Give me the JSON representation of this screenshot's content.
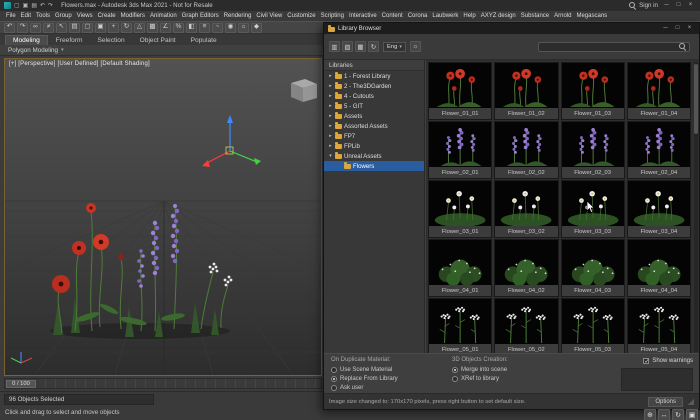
{
  "colors": {
    "selection_blue": "#2a5d9f",
    "folder_yellow": "#d9a63f",
    "poppy_red": "#c23020",
    "lupine_purple": "#9b80d2",
    "viewport_border": "#7a6234"
  },
  "titlebar": {
    "title": "Flowers.max - Autodesk 3ds Max 2021 - Not for Resale",
    "sign_in": "Sign in",
    "quick_access": [
      {
        "name": "new-scene-icon",
        "glyph": "▢"
      },
      {
        "name": "open-file-icon",
        "glyph": "▣"
      },
      {
        "name": "save-file-icon",
        "glyph": "▤"
      },
      {
        "name": "undo-icon",
        "glyph": "↶"
      },
      {
        "name": "redo-icon",
        "glyph": "↷"
      }
    ],
    "window_buttons": [
      {
        "name": "minimize-button",
        "glyph": "─"
      },
      {
        "name": "maximize-button",
        "glyph": "□"
      },
      {
        "name": "close-button",
        "glyph": "×"
      }
    ]
  },
  "menubar": {
    "items": [
      "File",
      "Edit",
      "Tools",
      "Group",
      "Views",
      "Create",
      "Modifiers",
      "Animation",
      "Graph Editors",
      "Rendering",
      "Civil View",
      "Customize",
      "Scripting",
      "Interactive",
      "Content",
      "Corona",
      "Laubwerk",
      "Help",
      "AXYZ design",
      "Substance",
      "Arnold",
      "Megascans"
    ]
  },
  "toolbar": {
    "icons": [
      {
        "name": "undo-icon",
        "glyph": "↶"
      },
      {
        "name": "redo-icon",
        "glyph": "↷"
      },
      {
        "name": "select-and-link-icon",
        "glyph": "∞"
      },
      {
        "name": "unlink-selection-icon",
        "glyph": "≠"
      },
      {
        "name": "select-object-icon",
        "glyph": "↖"
      },
      {
        "name": "select-by-name-icon",
        "glyph": "▤"
      },
      {
        "name": "rectangular-selection-icon",
        "glyph": "▢"
      },
      {
        "name": "window-crossing-icon",
        "glyph": "▣"
      },
      {
        "name": "select-and-move-icon",
        "glyph": "+"
      },
      {
        "name": "select-and-rotate-icon",
        "glyph": "↻"
      },
      {
        "name": "select-and-scale-icon",
        "glyph": "△"
      },
      {
        "name": "snaps-toggle-icon",
        "glyph": "▩"
      },
      {
        "name": "angle-snap-icon",
        "glyph": "∠"
      },
      {
        "name": "percent-snap-icon",
        "glyph": "%"
      },
      {
        "name": "mirror-icon",
        "glyph": "◧"
      },
      {
        "name": "align-icon",
        "glyph": "≡"
      },
      {
        "name": "curve-editor-icon",
        "glyph": "~"
      },
      {
        "name": "material-editor-icon",
        "glyph": "◉"
      },
      {
        "name": "render-setup-icon",
        "glyph": "☼"
      },
      {
        "name": "render-production-icon",
        "glyph": "◆"
      }
    ]
  },
  "ribbon": {
    "tabs": [
      {
        "label": "Modeling",
        "selected": true
      },
      {
        "label": "Freeform"
      },
      {
        "label": "Selection"
      },
      {
        "label": "Object Paint"
      },
      {
        "label": "Populate"
      }
    ],
    "section_label": "Polygon Modeling",
    "section_caret": "▾"
  },
  "viewport": {
    "label": "[+] [Perspective] [User Defined] [Default Shading]"
  },
  "trackbar": {
    "range": "0 / 100"
  },
  "statusbar": {
    "selection": "96 Objects Selected",
    "prompt": "Click and drag to select and move objects",
    "nav_icons": [
      {
        "name": "zoom-extents-icon",
        "glyph": "⊕"
      },
      {
        "name": "pan-view-icon",
        "glyph": "↔"
      },
      {
        "name": "orbit-view-icon",
        "glyph": "↻"
      },
      {
        "name": "maximize-viewport-icon",
        "glyph": "▣"
      }
    ]
  },
  "library": {
    "title": "Library Browser",
    "window_buttons": [
      {
        "name": "minimize-button",
        "glyph": "─"
      },
      {
        "name": "maximize-button",
        "glyph": "□"
      },
      {
        "name": "close-button",
        "glyph": "×"
      }
    ],
    "toolbar": {
      "icons": [
        {
          "name": "new-library-icon",
          "glyph": "▥"
        },
        {
          "name": "open-library-icon",
          "glyph": "▧"
        },
        {
          "name": "add-files-icon",
          "glyph": "▦"
        },
        {
          "name": "refresh-icon",
          "glyph": "↻"
        }
      ],
      "language": "Eng",
      "language_caret": "▾",
      "icons_right": [
        {
          "name": "settings-icon",
          "glyph": "☼"
        }
      ],
      "search_placeholder": ""
    },
    "tree": {
      "header": "Libraries",
      "items": [
        {
          "label": "1 - Forest Library",
          "arrow": "▸",
          "depth": 0
        },
        {
          "label": "2 - The3DGarden",
          "arrow": "▸",
          "depth": 0
        },
        {
          "label": "4 - Cutouts",
          "arrow": "▸",
          "depth": 0
        },
        {
          "label": "5 - GIT",
          "arrow": "▸",
          "depth": 0
        },
        {
          "label": "Assets",
          "arrow": "▸",
          "depth": 0
        },
        {
          "label": "Assorted Assets",
          "arrow": "▸",
          "depth": 0
        },
        {
          "label": "FP7",
          "arrow": "▸",
          "depth": 0
        },
        {
          "label": "FPLib",
          "arrow": "▸",
          "depth": 0
        },
        {
          "label": "Unreal Assets",
          "arrow": "▾",
          "depth": 0
        },
        {
          "label": "Flowers",
          "arrow": "",
          "depth": 1,
          "selected": true
        }
      ]
    },
    "grid": {
      "items": [
        {
          "label": "Flower_01_01",
          "art": "art-poppy"
        },
        {
          "label": "Flower_01_02",
          "art": "art-poppy"
        },
        {
          "label": "Flower_01_03",
          "art": "art-poppy"
        },
        {
          "label": "Flower_01_04",
          "art": "art-poppy"
        },
        {
          "label": "Flower_02_01",
          "art": "art-lupine"
        },
        {
          "label": "Flower_02_02",
          "art": "art-lupine"
        },
        {
          "label": "Flower_02_03",
          "art": "art-lupine"
        },
        {
          "label": "Flower_02_04",
          "art": "art-lupine"
        },
        {
          "label": "Flower_03_01",
          "art": "art-daisy"
        },
        {
          "label": "Flower_03_02",
          "art": "art-daisy"
        },
        {
          "label": "Flower_03_03",
          "art": "art-daisy"
        },
        {
          "label": "Flower_03_04",
          "art": "art-daisy"
        },
        {
          "label": "Flower_04_01",
          "art": "art-bush"
        },
        {
          "label": "Flower_04_02",
          "art": "art-bush"
        },
        {
          "label": "Flower_04_03",
          "art": "art-bush"
        },
        {
          "label": "Flower_04_04",
          "art": "art-bush"
        },
        {
          "label": "Flower_05_01",
          "art": "art-yarrow"
        },
        {
          "label": "Flower_05_02",
          "art": "art-yarrow"
        },
        {
          "label": "Flower_05_03",
          "art": "art-yarrow"
        },
        {
          "label": "Flower_05_04",
          "art": "art-yarrow"
        }
      ]
    },
    "footer": {
      "material_header": "On Duplicate Material:",
      "material_options": [
        {
          "label": "Use Scene Material",
          "checked": false
        },
        {
          "label": "Replace From Library",
          "checked": true
        },
        {
          "label": "Ask user",
          "checked": false
        }
      ],
      "objects_header": "3D Objects Creation:",
      "objects_options": [
        {
          "label": "Merge into scene",
          "checked": true
        },
        {
          "label": "XRef to library",
          "checked": false
        }
      ],
      "show_warnings": {
        "label": "Show warnings",
        "checked": true
      },
      "status": "Image size changed to: 170x170 pixels, press right button to set default size.",
      "options_button": "Options"
    }
  }
}
